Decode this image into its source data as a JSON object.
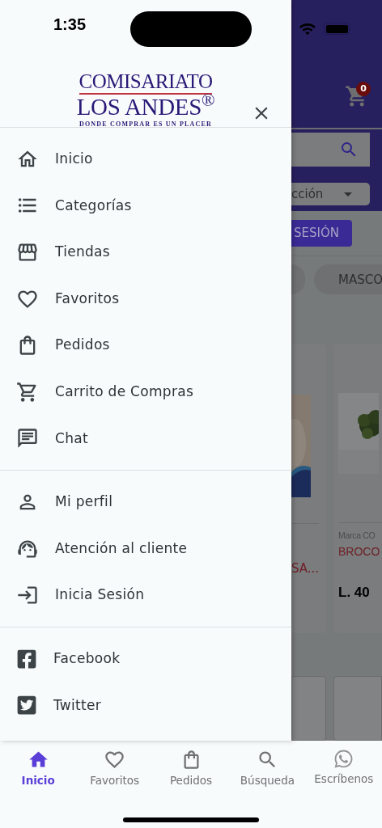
{
  "status_bar": {
    "time": "1:35"
  },
  "drawer": {
    "logo": {
      "line1": "COMISARIATO",
      "line2": "LOS ANDES$^{®}$",
      "tagline": "DONDE COMPRAR ES UN PLACER"
    },
    "sections": [
      {
        "items": [
          {
            "kind": "home",
            "label": "Inicio"
          },
          {
            "kind": "list",
            "label": "Categorías"
          },
          {
            "kind": "store",
            "label": "Tiendas"
          },
          {
            "kind": "heart",
            "label": "Favoritos"
          },
          {
            "kind": "bag",
            "label": "Pedidos"
          },
          {
            "kind": "cart",
            "label": "Carrito de Compras"
          },
          {
            "kind": "chat",
            "label": "Chat"
          }
        ]
      },
      {
        "items": [
          {
            "kind": "person",
            "label": "Mi perfil"
          },
          {
            "kind": "agent",
            "label": "Atención al cliente"
          },
          {
            "kind": "login",
            "label": "Inicia Sesión"
          }
        ]
      },
      {
        "items": [
          {
            "kind": "facebook",
            "label": "Facebook"
          },
          {
            "kind": "twitter",
            "label": "Twitter"
          }
        ]
      }
    ]
  },
  "background": {
    "cart_count": "0",
    "select_value": "cción",
    "login_button": "SESIÓN",
    "chip": "MASCO",
    "cards": [
      {
        "title": "SA..."
      },
      {
        "brand": "Marca CO",
        "title": "BROCO",
        "price": "L. 40"
      }
    ]
  },
  "bottom_nav": [
    {
      "kind": "home",
      "label": "Inicio",
      "selected": true
    },
    {
      "kind": "heart",
      "label": "Favoritos",
      "selected": false
    },
    {
      "kind": "bag",
      "label": "Pedidos",
      "selected": false
    },
    {
      "kind": "search",
      "label": "Búsqueda",
      "selected": false
    },
    {
      "kind": "whatsapp",
      "label": "Escríbenos",
      "selected": false
    }
  ]
}
